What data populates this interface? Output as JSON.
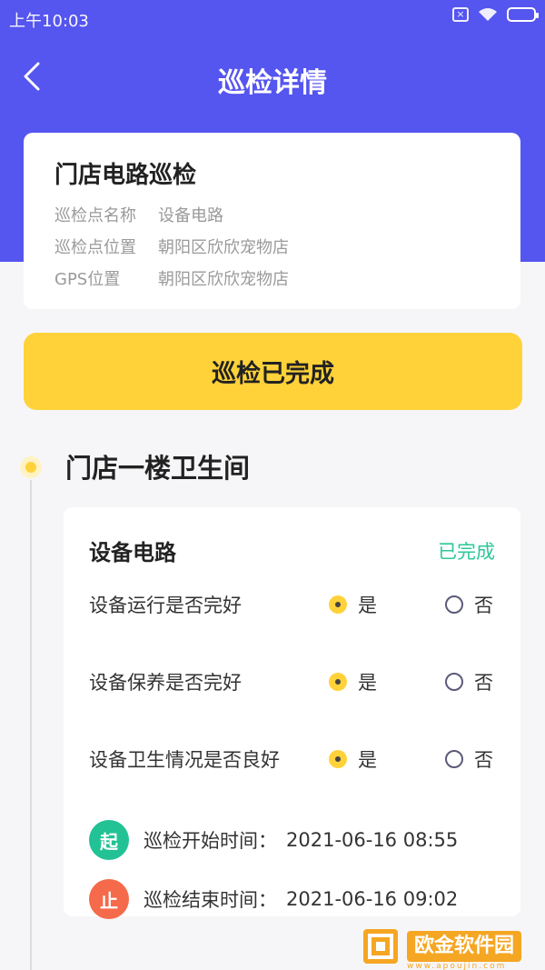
{
  "status_bar": {
    "time": "上午10:03"
  },
  "navbar": {
    "title": "巡检详情"
  },
  "info_card": {
    "title": "门店电路巡检",
    "rows": [
      {
        "label": "巡检点名称",
        "value": "设备电路"
      },
      {
        "label": "巡检点位置",
        "value": "朝阳区欣欣宠物店"
      },
      {
        "label": "GPS位置",
        "value": "朝阳区欣欣宠物店"
      }
    ]
  },
  "complete_button": {
    "label": "巡检已完成"
  },
  "section": {
    "title": "门店一楼卫生间"
  },
  "detail_card": {
    "title": "设备电路",
    "status": "已完成",
    "questions": [
      {
        "text": "设备运行是否完好",
        "yes": "是",
        "no": "否",
        "selected": "yes"
      },
      {
        "text": "设备保养是否完好",
        "yes": "是",
        "no": "否",
        "selected": "yes"
      },
      {
        "text": "设备卫生情况是否良好",
        "yes": "是",
        "no": "否",
        "selected": "yes"
      }
    ],
    "start": {
      "badge": "起",
      "label": "巡检开始时间：",
      "value": "2021-06-16 08:55"
    },
    "end": {
      "badge": "止",
      "label": "巡检结束时间：",
      "value": "2021-06-16 09:02"
    }
  },
  "watermark": {
    "text": "欧金软件园",
    "sub": "www.apoujin.com"
  },
  "colors": {
    "header": "#5555ef",
    "accent_yellow": "#ffd23a",
    "status_green": "#2ec79a",
    "start_badge": "#22c295",
    "end_badge": "#f56a4a"
  }
}
